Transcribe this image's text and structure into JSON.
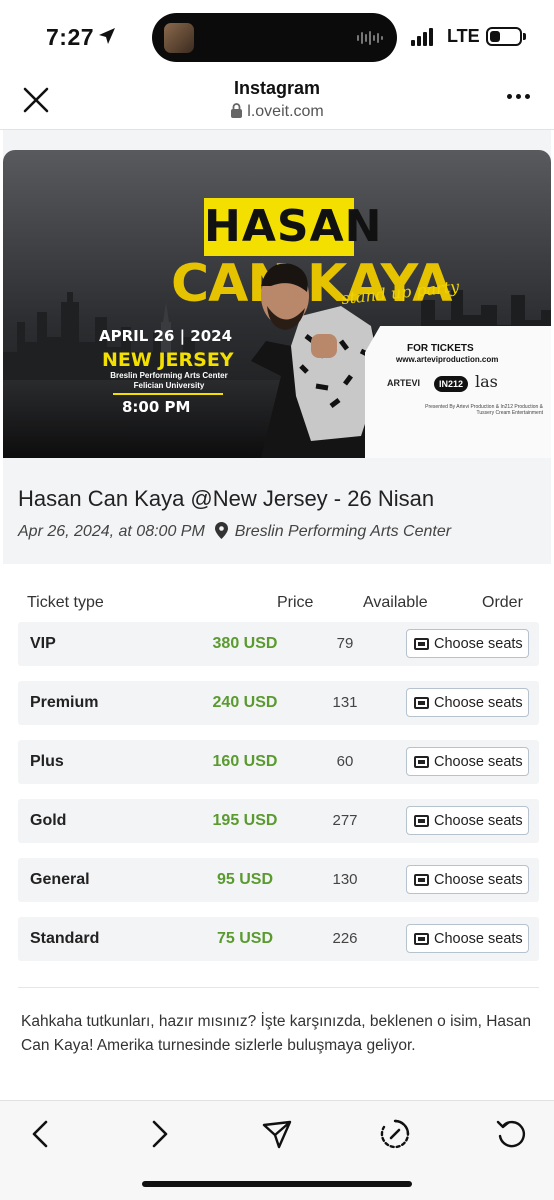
{
  "status_bar": {
    "time": "7:27",
    "network": "LTE"
  },
  "browser": {
    "title": "Instagram",
    "url": "l.oveit.com",
    "icons": {
      "close": "close-icon",
      "more": "more-icon",
      "lock": "lock-icon"
    }
  },
  "banner": {
    "title_line1": "HASAN",
    "title_line2": "CAN KAYA",
    "subtitle": "stand up party",
    "date": "APRIL 26 | 2024",
    "city": "NEW JERSEY",
    "venue_line1": "Breslin Performing Arts Center",
    "venue_line2": "Felician University",
    "time": "8:00 PM",
    "tickets_label": "FOR TICKETS",
    "tickets_url": "www.arteviproduction.com",
    "logo1": "ARTEVI",
    "logo2": "IN212",
    "logo3": "las",
    "presented": "Presented By Artevi Production & In212 Production & Tussery Cream Entertainment"
  },
  "event": {
    "title": "Hasan Can Kaya @New Jersey - 26 Nisan",
    "datetime": "Apr 26, 2024, at 08:00 PM",
    "venue": "Breslin Performing Arts Center"
  },
  "tickets": {
    "headers": {
      "type": "Ticket type",
      "price": "Price",
      "available": "Available",
      "order": "Order"
    },
    "button_label": "Choose seats",
    "rows": [
      {
        "type": "VIP",
        "price": "380 USD",
        "available": "79"
      },
      {
        "type": "Premium",
        "price": "240 USD",
        "available": "131"
      },
      {
        "type": "Plus",
        "price": "160 USD",
        "available": "60"
      },
      {
        "type": "Gold",
        "price": "195 USD",
        "available": "277"
      },
      {
        "type": "General",
        "price": "95 USD",
        "available": "130"
      },
      {
        "type": "Standard",
        "price": "75 USD",
        "available": "226"
      }
    ]
  },
  "description": "Kahkaha tutkunları, hazır mısınız? İşte karşınızda, beklenen o isim, Hasan Can Kaya! Amerika turnesinde sizlerle buluşmaya geliyor.",
  "toolbar": {
    "icons": [
      "back-icon",
      "forward-icon",
      "share-icon",
      "compass-icon",
      "reload-icon"
    ]
  },
  "colors": {
    "price_green": "#5a9a2f",
    "banner_yellow": "#f3e000"
  }
}
